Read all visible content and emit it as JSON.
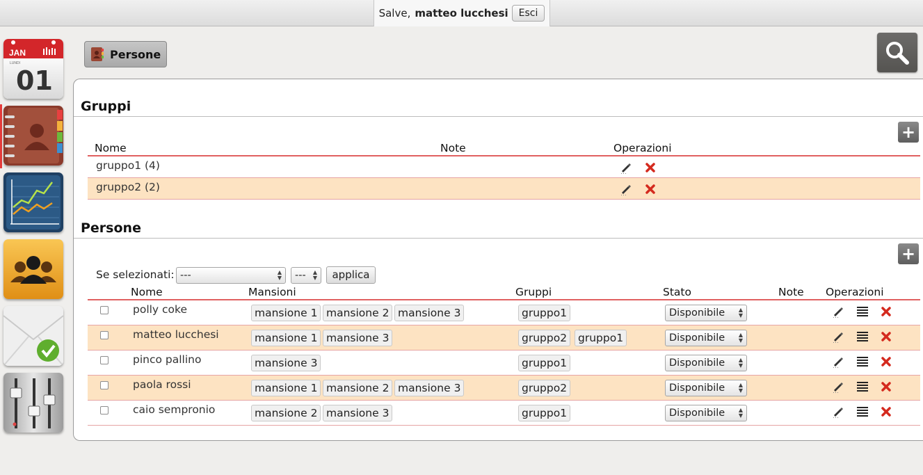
{
  "header": {
    "greeting_prefix": "Salve,",
    "username": "matteo lucchesi",
    "logout_label": "Esci"
  },
  "sidebar": {
    "calendar": {
      "month": "JAN",
      "day_name": "LUNDI",
      "day": "01"
    },
    "items": [
      {
        "icon": "calendar-icon",
        "active": false
      },
      {
        "icon": "address-book-icon",
        "active": true
      },
      {
        "icon": "chart-icon",
        "active": false
      },
      {
        "icon": "people-icon",
        "active": false
      },
      {
        "icon": "mail-check-icon",
        "active": false
      },
      {
        "icon": "mixer-icon",
        "active": false
      }
    ]
  },
  "toolbar": {
    "section_label": "Persone"
  },
  "gruppi": {
    "title": "Gruppi",
    "columns": [
      "Nome",
      "Note",
      "Operazioni"
    ],
    "rows": [
      {
        "nome": "gruppo1 (4)",
        "note": ""
      },
      {
        "nome": "gruppo2 (2)",
        "note": ""
      }
    ]
  },
  "persone": {
    "title": "Persone",
    "bulk_label": "Se selezionati:",
    "bulk_action_value": "---",
    "bulk_target_value": "---",
    "apply_label": "applica",
    "columns": [
      "Nome",
      "Mansioni",
      "Gruppi",
      "Stato",
      "Note",
      "Operazioni"
    ],
    "rows": [
      {
        "nome": "polly coke",
        "mansioni": [
          "mansione 1",
          "mansione 2",
          "mansione 3"
        ],
        "gruppi": [
          "gruppo1"
        ],
        "stato": "Disponibile",
        "note": ""
      },
      {
        "nome": "matteo lucchesi",
        "mansioni": [
          "mansione 1",
          "mansione 3"
        ],
        "gruppi": [
          "gruppo2",
          "gruppo1"
        ],
        "stato": "Disponibile",
        "note": ""
      },
      {
        "nome": "pinco pallino",
        "mansioni": [
          "mansione 3"
        ],
        "gruppi": [
          "gruppo1"
        ],
        "stato": "Disponibile",
        "note": ""
      },
      {
        "nome": "paola rossi",
        "mansioni": [
          "mansione 1",
          "mansione 2",
          "mansione 3"
        ],
        "gruppi": [
          "gruppo2"
        ],
        "stato": "Disponibile",
        "note": ""
      },
      {
        "nome": "caio sempronio",
        "mansioni": [
          "mansione 2",
          "mansione 3"
        ],
        "gruppi": [
          "gruppo1"
        ],
        "stato": "Disponibile",
        "note": ""
      }
    ]
  },
  "colors": {
    "row_alt_bg": "#fde3c2",
    "header_rule": "#e06060",
    "delete_red": "#d42a1e",
    "active_marker": "#e53b3b"
  }
}
